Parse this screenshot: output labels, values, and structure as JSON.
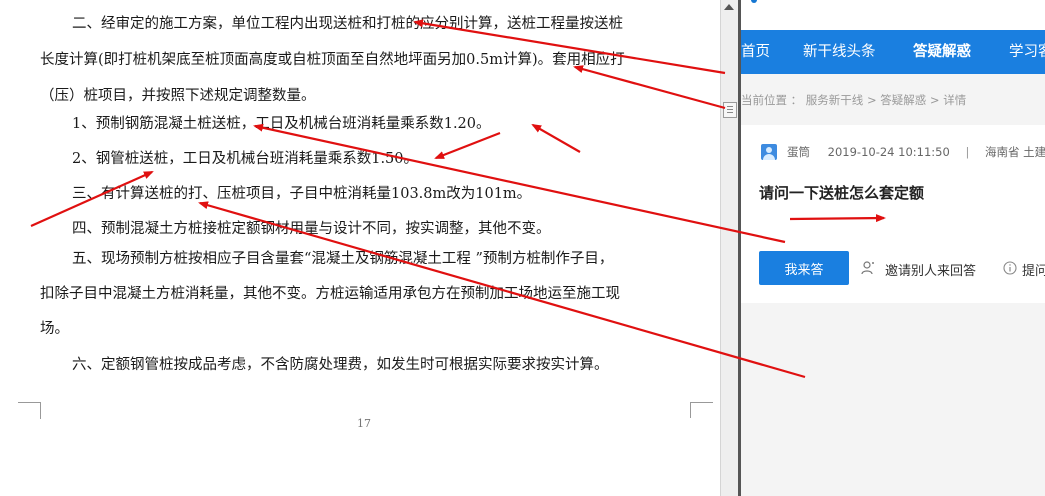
{
  "document": {
    "para1": {
      "line1": "二、经审定的施工方案，单位工程内出现送桩和打桩的应分别计算，送桩工程量按送桩",
      "line2": "长度计算(即打桩机架底至桩顶面高度或自桩顶面至自然地坪面另加0.5m计算)。套用相应打",
      "line3": "（压）桩项目，并按照下述规定调整数量。"
    },
    "para2": "1、预制钢筋混凝土桩送桩，工日及机械台班消耗量乘系数1.20。",
    "para3": "2、钢管桩送桩，工日及机械台班消耗量乘系数1.50。",
    "para4": "三、有计算送桩的打、压桩项目，子目中桩消耗量103.8m改为101m。",
    "para5": "四、预制混凝土方桩接桩定额钢材用量与设计不同，按实调整，其他不变。",
    "para6": {
      "line1": "五、现场预制方桩按相应子目含量套“混凝土及钢筋混凝土工程 ”预制方桩制作子目，",
      "line2": "扣除子目中混凝土方桩消耗量，其他不变。方桩运输适用承包方在预制加工场地运至施工现",
      "line3": "场。"
    },
    "para7": "六、定额钢管桩按成品考虑，不含防腐处理费，如发生时可根据实际要求按实计算。",
    "page_number": "17"
  },
  "web": {
    "nav": [
      "首页",
      "新干线头条",
      "答疑解惑",
      "学习客"
    ],
    "breadcrumb": "当前位置 ： 服务新干线 > 答疑解惑 > 详情",
    "meta": {
      "user": "蛋筒",
      "datetime": "2019-10-24 10:11:50",
      "separator": "|",
      "location": "海南省  土建"
    },
    "question_title": "请问一下送桩怎么套定额",
    "answer_button": "我来答",
    "invite": "邀请别人来回答",
    "ask": "提问"
  },
  "colors": {
    "nav_blue": "#1a7fe0",
    "arrow_red": "#e01010"
  }
}
